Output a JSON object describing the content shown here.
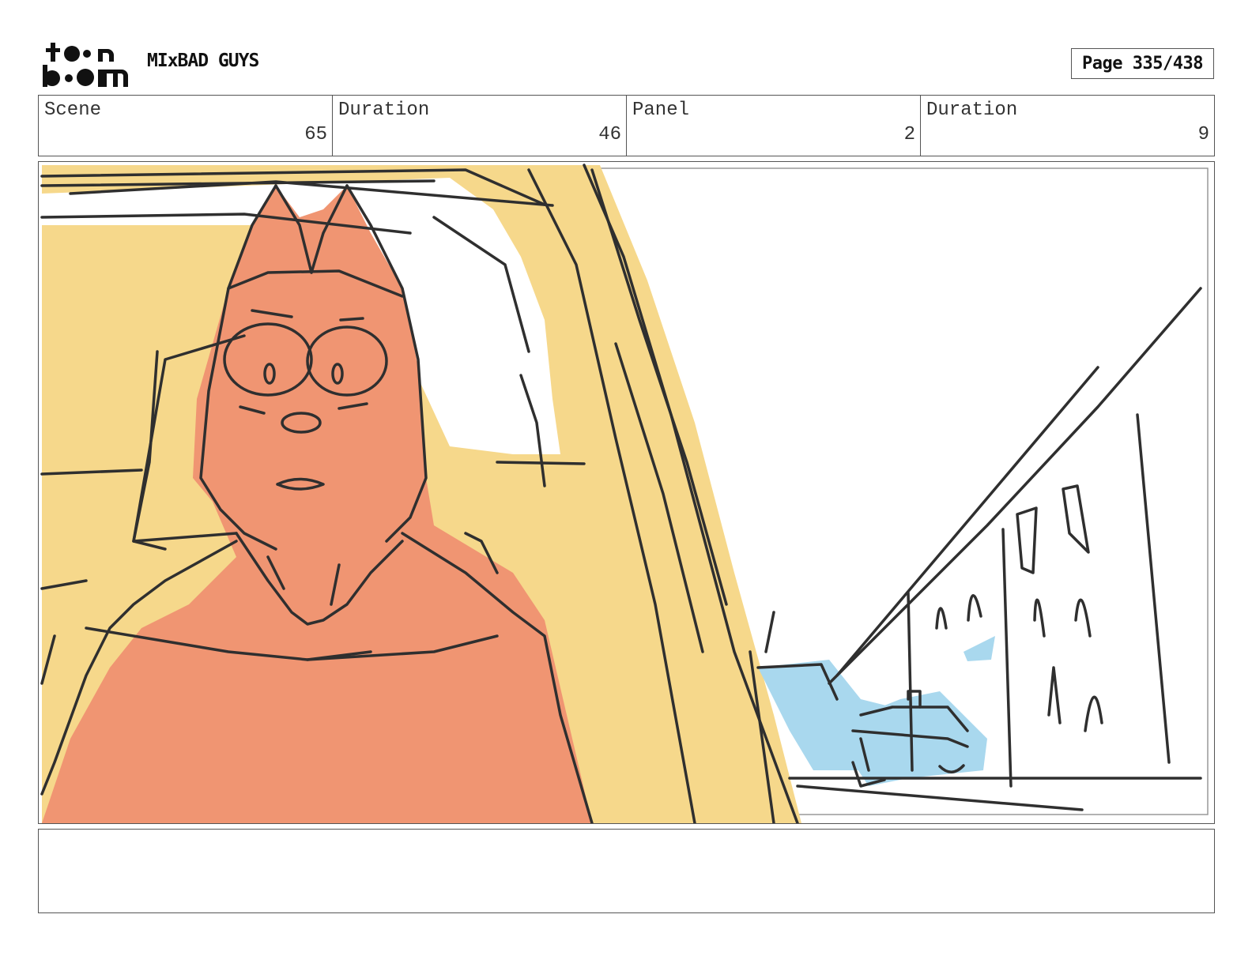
{
  "header": {
    "logo_icon": "toon-boom-logo",
    "logo_text_top": "toon",
    "logo_text_bottom": "boom",
    "project_title": "MIxBAD GUYS",
    "page_label": "Page 335/438"
  },
  "info": {
    "scene_label": "Scene",
    "scene_value": "65",
    "scene_duration_label": "Duration",
    "scene_duration_value": "46",
    "panel_label": "Panel",
    "panel_value": "2",
    "panel_duration_label": "Duration",
    "panel_duration_value": "9"
  },
  "panel": {
    "image_icon": "storyboard-sketch-image",
    "colors": {
      "character": "#f09572",
      "car_interior": "#f6d88b",
      "cars": "#a9d8ee",
      "line": "#2f2f2f"
    }
  },
  "notes": {
    "text": ""
  }
}
